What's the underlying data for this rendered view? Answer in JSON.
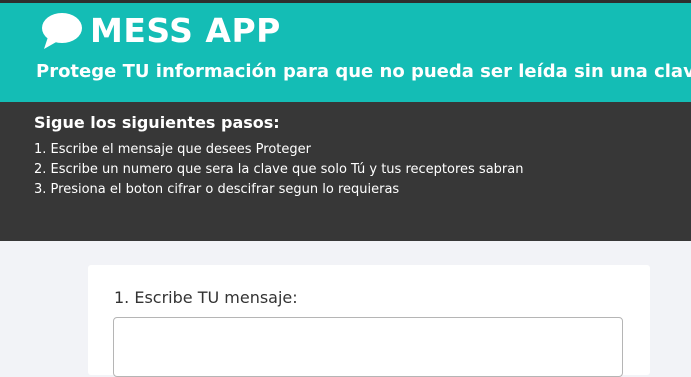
{
  "header": {
    "logo_icon": "chat-bubble-icon",
    "app_title": "MESS APP",
    "tagline": "Protege TU información para que no pueda ser leída sin una clave."
  },
  "instructions": {
    "title": "Sigue los siguientes pasos:",
    "steps": [
      "1. Escribe el mensaje que desees Proteger",
      "2. Escribe un numero que sera la clave que solo Tú y tus receptores sabran",
      "3. Presiona el boton cifrar o descifrar segun lo requieras"
    ]
  },
  "form": {
    "message_label": "1. Escribe TU mensaje:",
    "message_value": ""
  },
  "colors": {
    "header_bg": "#14bdb5",
    "steps_bg": "#373737",
    "page_bg": "#f2f3f7"
  }
}
